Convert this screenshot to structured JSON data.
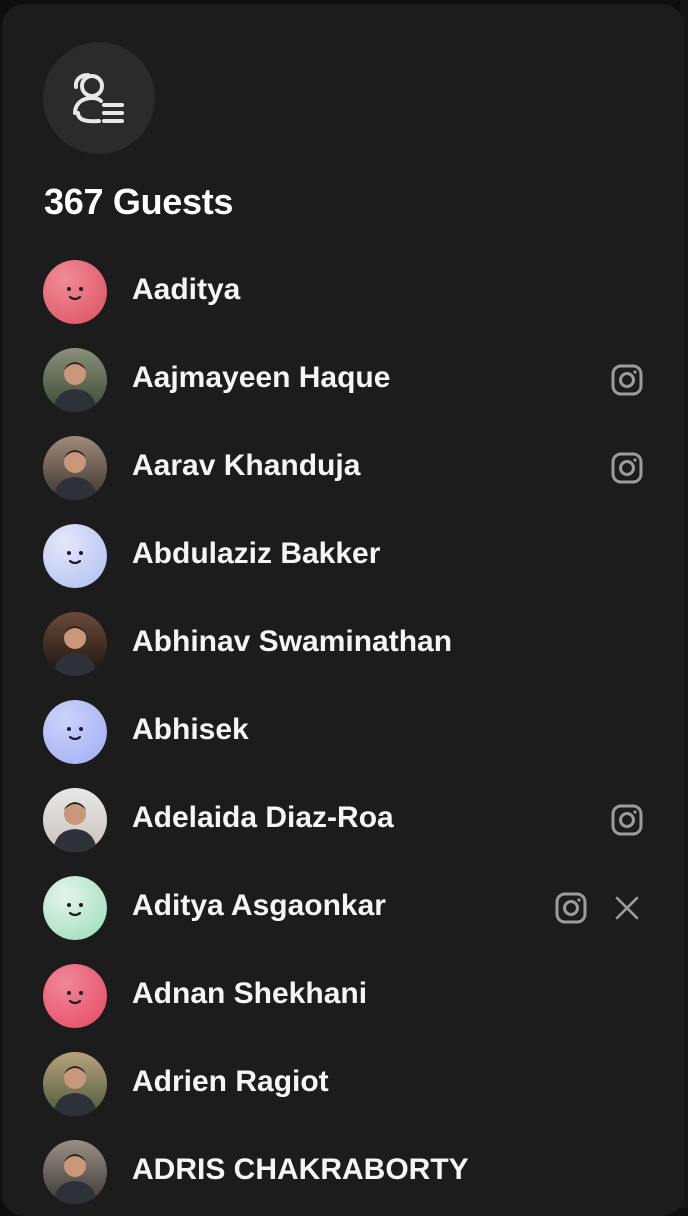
{
  "header": {
    "icon": "guest-list-icon",
    "title": "367 Guests"
  },
  "guests": [
    {
      "name": "Aaditya",
      "avatar": "smiley",
      "colors": [
        "#f28b96",
        "#e05c6b"
      ],
      "social": []
    },
    {
      "name": "Aajmayeen Haque",
      "avatar": "photo",
      "colors": [
        "#8a8f7a",
        "#3a4a34"
      ],
      "social": [
        "instagram-icon"
      ]
    },
    {
      "name": "Aarav Khanduja",
      "avatar": "photo",
      "colors": [
        "#a08a7a",
        "#3c3530"
      ],
      "social": [
        "instagram-icon"
      ]
    },
    {
      "name": "Abdulaziz Bakker",
      "avatar": "smiley",
      "colors": [
        "#e6e6fb",
        "#b9c7f2"
      ],
      "social": []
    },
    {
      "name": "Abhinav Swaminathan",
      "avatar": "photo",
      "colors": [
        "#6a4a3a",
        "#1c1410"
      ],
      "social": []
    },
    {
      "name": "Abhisek",
      "avatar": "smiley",
      "colors": [
        "#cdd2fb",
        "#a9b5f5"
      ],
      "social": []
    },
    {
      "name": "Adelaida Diaz-Roa",
      "avatar": "photo",
      "colors": [
        "#e8e8e8",
        "#c9c2bb"
      ],
      "social": [
        "instagram-icon"
      ]
    },
    {
      "name": "Aditya Asgaonkar",
      "avatar": "smiley",
      "colors": [
        "#e4f3ec",
        "#a8e1c2"
      ],
      "social": [
        "instagram-icon",
        "x-icon"
      ]
    },
    {
      "name": "Adnan Shekhani",
      "avatar": "smiley",
      "colors": [
        "#f0879a",
        "#e8566d"
      ],
      "social": []
    },
    {
      "name": "Adrien Ragiot",
      "avatar": "photo",
      "colors": [
        "#b9a27e",
        "#4a5a3a"
      ],
      "social": []
    },
    {
      "name": "ADRIS CHAKRABORTY",
      "avatar": "photo",
      "colors": [
        "#9a8f86",
        "#3a3836"
      ],
      "social": []
    }
  ]
}
